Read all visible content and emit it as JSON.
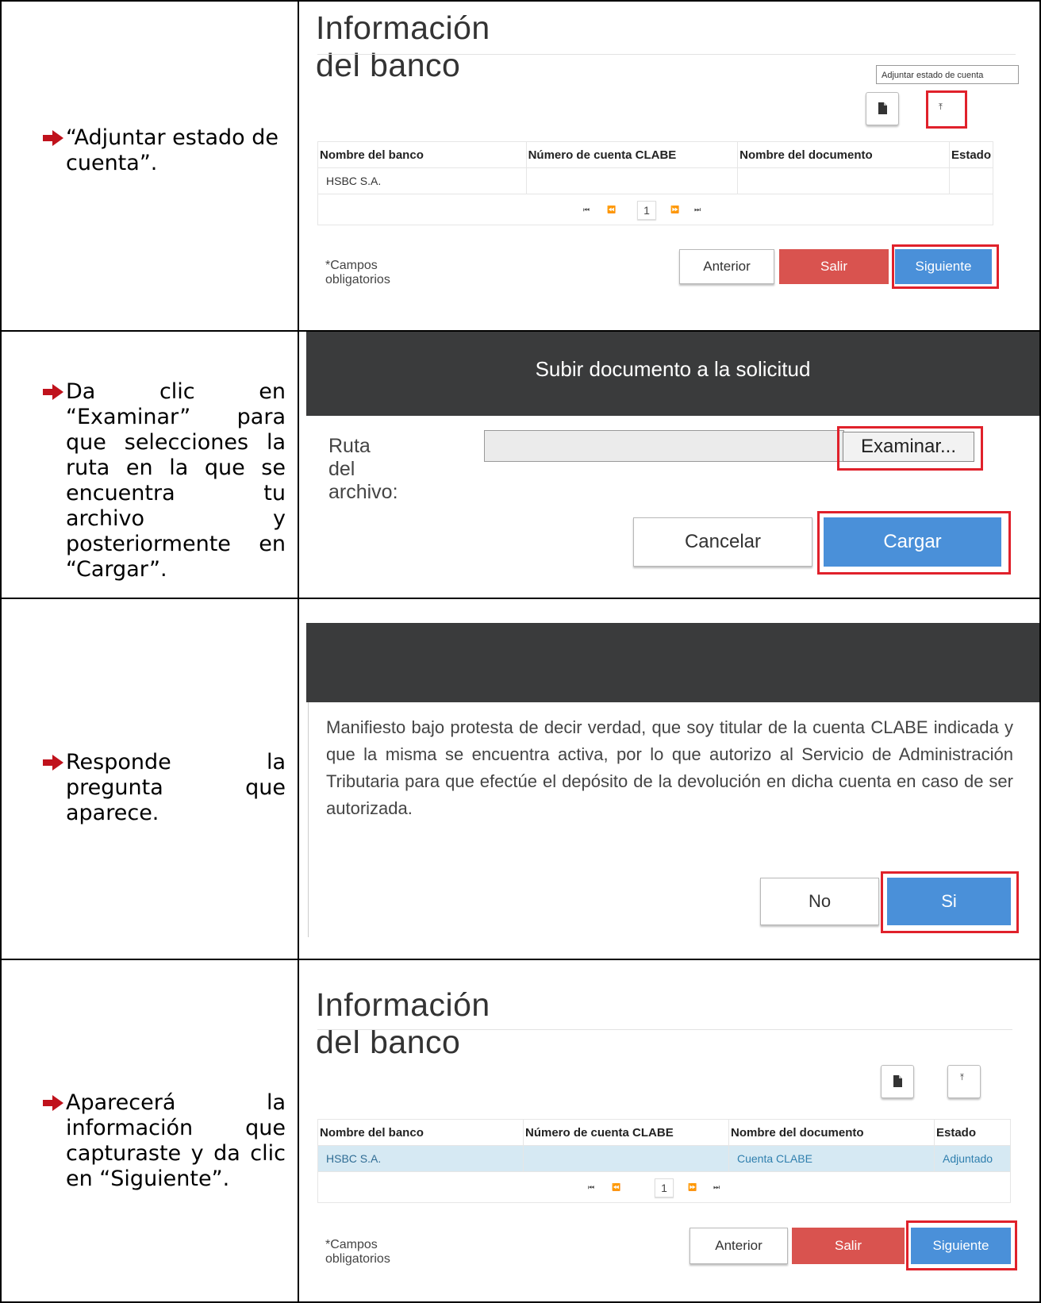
{
  "instructions": [
    "“Adjuntar estado de cuenta”.",
    "Da clic en “Examinar” para que selecciones la ruta en la que se encuentra tu archivo y posteriormente en “Cargar”.",
    "Responde la pregunta que aparece.",
    "Aparecerá la información que capturaste y da clic en “Siguiente”."
  ],
  "step1": {
    "title": "Información del banco",
    "tooltip": "Adjuntar estado de cuenta",
    "icons": [
      "file-icon",
      "upload-icon"
    ],
    "columns": [
      "Nombre del banco",
      "Número de cuenta CLABE",
      "Nombre del documento",
      "Estado"
    ],
    "rows": [
      [
        "HSBC S.A.",
        "",
        "",
        ""
      ]
    ],
    "pager": {
      "first": "⏮",
      "prev": "⏪",
      "page": "1",
      "next": "⏩",
      "last": "⏭"
    },
    "required_note": "*Campos obligatorios",
    "buttons": {
      "prev": "Anterior",
      "exit": "Salir",
      "next": "Siguiente"
    }
  },
  "step2": {
    "title": "Subir documento a la solicitud",
    "field_label": "Ruta del archivo:",
    "file_value": "",
    "browse": "Examinar...",
    "cancel": "Cancelar",
    "upload": "Cargar"
  },
  "step3": {
    "declaration": "Manifiesto bajo protesta de decir verdad, que soy titular de la cuenta CLABE indicada y que la misma se encuentra activa, por lo que autorizo al Servicio de Administración Tributaria para que efectúe el depósito de la devolución en dicha cuenta en caso de ser autorizada.",
    "no": "No",
    "yes": "Si"
  },
  "step4": {
    "title": "Información del banco",
    "columns": [
      "Nombre del banco",
      "Número de cuenta CLABE",
      "Nombre del documento",
      "Estado"
    ],
    "rows": [
      [
        "HSBC S.A.",
        "",
        "Cuenta CLABE",
        "Adjuntado"
      ]
    ],
    "pager": {
      "first": "⏮",
      "prev": "⏪",
      "page": "1",
      "next": "⏩",
      "last": "⏭"
    },
    "required_note": "*Campos obligatorios",
    "buttons": {
      "prev": "Anterior",
      "exit": "Salir",
      "next": "Siguiente"
    }
  },
  "colors": {
    "highlight": "#e0212b",
    "blue": "#4a90d9",
    "red": "#d9534f",
    "dark": "#3a3b3c",
    "arrow": "#c0121c"
  }
}
